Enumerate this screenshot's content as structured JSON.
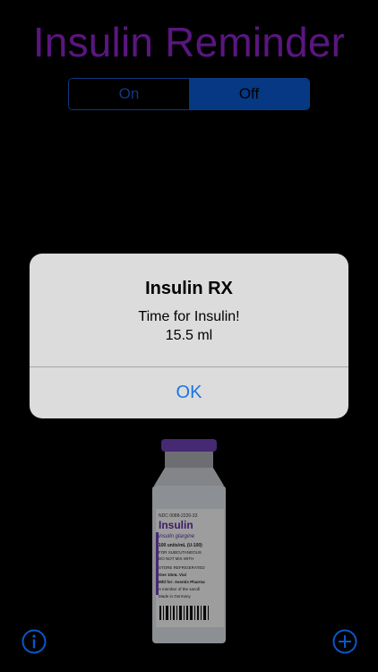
{
  "app": {
    "title": "Insulin Reminder"
  },
  "toggle": {
    "on_label": "On",
    "off_label": "Off",
    "selected": "Off"
  },
  "alert": {
    "title": "Insulin RX",
    "message_line1": "Time for Insulin!",
    "message_line2": "15.5 ml",
    "ok_label": "OK"
  },
  "vial_label": {
    "ndc": "NDC 0088-2220-33",
    "brand": "Insulin",
    "generic": "insulin glargine",
    "line1": "100 units/mL (U-100)",
    "line2": "FOR SUBCUTANEOUS",
    "line3": "DO NOT MIX WITH",
    "line4": "STORE REFRIGERATED",
    "line5": "One 10mL Vial",
    "line6": "Mfd for: Aventis Pharma",
    "line7": "A member of the sanofi",
    "line8": "Made in Germany"
  },
  "colors": {
    "title": "#8a22c4",
    "accent_blue": "#0a57c9",
    "alert_bg": "#dcdcdc",
    "alert_button": "#1a73e8"
  },
  "icons": {
    "info": "info-icon",
    "add": "add-icon"
  }
}
